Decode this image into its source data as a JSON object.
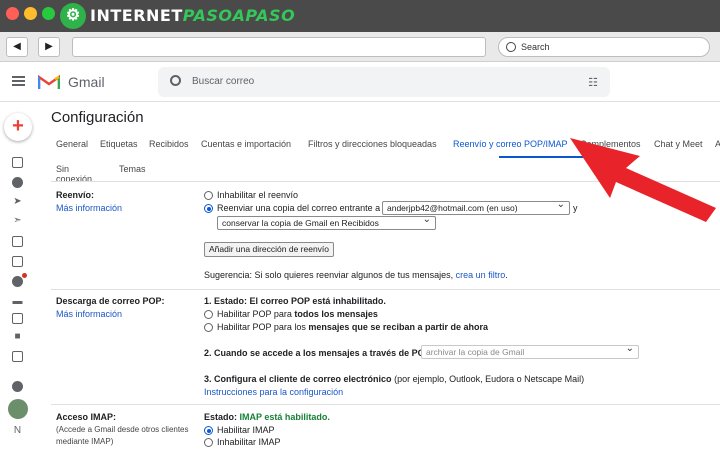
{
  "site": {
    "name_part1": "INTERNET",
    "name_part2": "PASOAPASO",
    "search_label": "Search"
  },
  "gmail": {
    "logo_text": "Gmail",
    "search_placeholder": "Buscar correo"
  },
  "settings": {
    "title": "Configuración",
    "tabs": [
      "General",
      "Etiquetas",
      "Recibidos",
      "Cuentas e importación",
      "Filtros y direcciones bloqueadas",
      "Reenvío y correo POP/IMAP",
      "Complementos",
      "Chat y Meet",
      "A"
    ],
    "active_tab": "Reenvío y correo POP/IMAP",
    "tabs_row2": [
      "Sin conexión",
      "Temas"
    ],
    "forwarding": {
      "label": "Reenvío:",
      "more_info": "Más información",
      "disable": "Inhabilitar el reenvío",
      "forward_prefix": "Reenviar una copia del correo entrante a",
      "address": "anderjpb42@hotmail.com (en uso)",
      "and": "y",
      "keep_option": "conservar la copia de Gmail en Recibidos",
      "add_button": "Añadir una dirección de reenvío",
      "tip_prefix": "Sugerencia: Si solo quieres reenviar algunos de tus mensajes,",
      "tip_link": "crea un filtro",
      "tip_suffix": "."
    },
    "pop": {
      "label": "Descarga de correo POP:",
      "more_info": "Más información",
      "status_prefix": "1. Estado: El correo POP está inhabilitado.",
      "enable_all_prefix": "Habilitar POP para",
      "enable_all_bold": "todos los mensajes",
      "enable_new_prefix": "Habilitar POP para los",
      "enable_new_bold": "mensajes que se reciban a partir de ahora",
      "step2": "2. Cuando se accede a los mensajes a través de POP",
      "step2_select": "archivar la copia de Gmail",
      "step3_bold": "3. Configura el cliente de correo electrónico",
      "step3_rest": "(por ejemplo, Outlook, Eudora o Netscape Mail)",
      "instructions": "Instrucciones para la configuración"
    },
    "imap": {
      "label": "Acceso IMAP:",
      "note": "(Accede a Gmail desde otros clientes mediante IMAP)",
      "status_prefix": "Estado:",
      "status_value": "IMAP está habilitado.",
      "enable": "Habilitar IMAP",
      "disable": "Inhabilitar IMAP"
    }
  },
  "rail": {
    "n_label": "N"
  },
  "colors": {
    "arrow": "#e8232a",
    "accent": "#0b57d0",
    "link": "#1a57c5",
    "brand_green": "#2fb24a"
  }
}
